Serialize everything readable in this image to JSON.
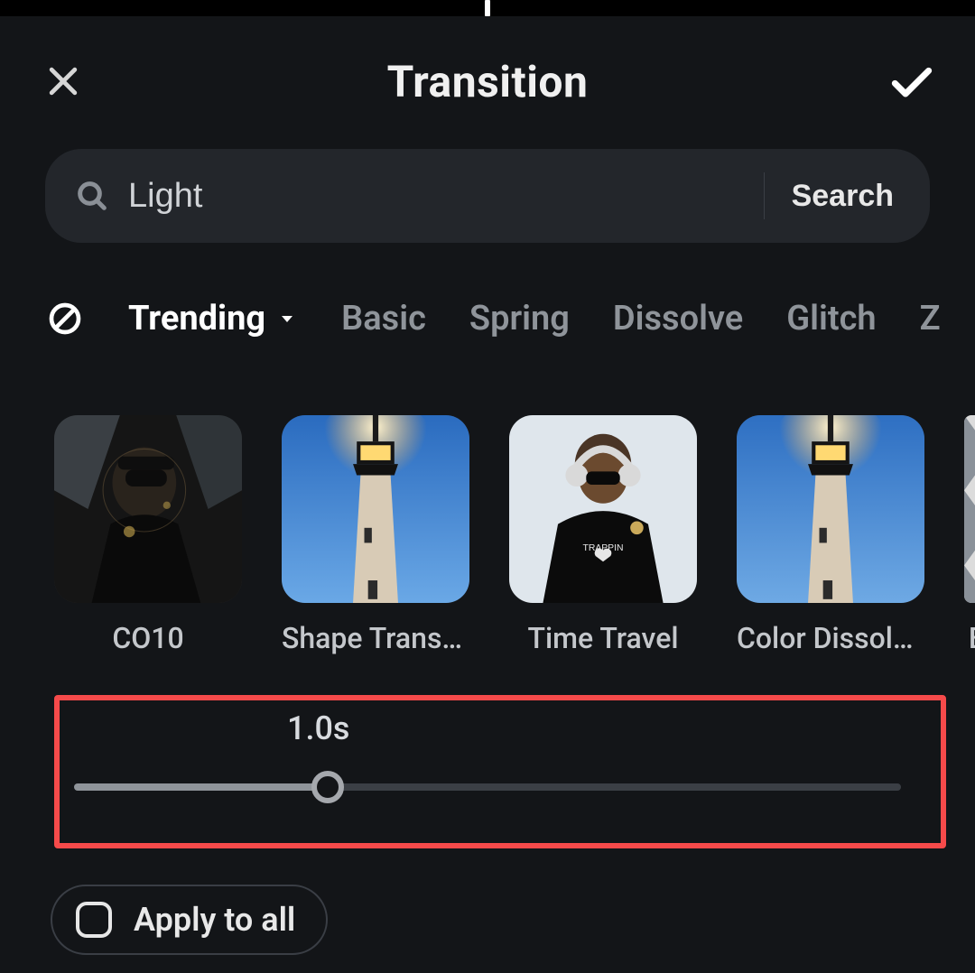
{
  "header": {
    "title": "Transition"
  },
  "search": {
    "value": "Light",
    "placeholder": "",
    "button_label": "Search"
  },
  "categories": {
    "items": [
      {
        "label": "Trending",
        "active": true,
        "dropdown": true
      },
      {
        "label": "Basic"
      },
      {
        "label": "Spring"
      },
      {
        "label": "Dissolve"
      },
      {
        "label": "Glitch"
      },
      {
        "label": "Z"
      }
    ]
  },
  "gallery": {
    "items": [
      {
        "label": "CO10",
        "thumb": "person-dark"
      },
      {
        "label": "Shape Transit…",
        "thumb": "lighthouse"
      },
      {
        "label": "Time Travel",
        "thumb": "person-headphones"
      },
      {
        "label": "Color Dissolv…",
        "thumb": "lighthouse"
      },
      {
        "label": "B",
        "thumb": "pattern",
        "partial": true
      }
    ]
  },
  "duration": {
    "display": "1.0s",
    "fraction": 0.307
  },
  "apply_all": {
    "label": "Apply to all",
    "checked": false
  },
  "colors": {
    "highlight_border": "#f64a4a"
  }
}
